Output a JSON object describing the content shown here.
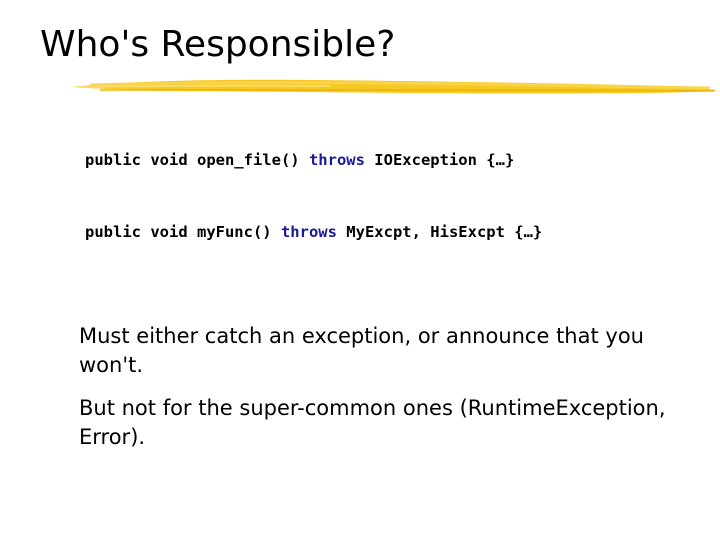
{
  "slide": {
    "title": "Who's Responsible?",
    "accent_color": "#f5c518",
    "code": {
      "keyword_color": "#1a1a99",
      "lines": [
        {
          "before": "public void open_file() ",
          "keyword": "throws",
          "after": " IOException {…}"
        },
        {
          "before": "public void myFunc() ",
          "keyword": "throws",
          "after": " MyExcpt, HisExcpt {…}"
        }
      ]
    },
    "bullets": [
      "Must either catch an exception, or announce that you won't.",
      "But not for the super-common ones (RuntimeException, Error)."
    ]
  }
}
